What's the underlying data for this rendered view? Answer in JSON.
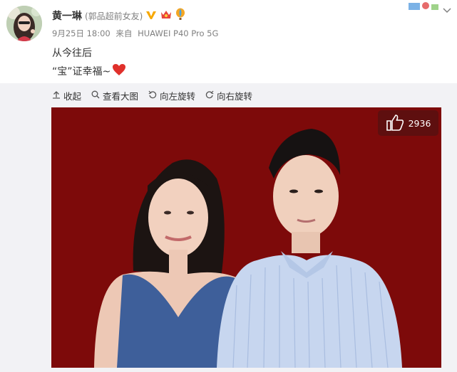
{
  "user": {
    "name": "黄一琳",
    "remark": "(郭品超前女友)"
  },
  "meta": {
    "time": "9月25日 18:00",
    "source_prefix": "来自",
    "device": "HUAWEI P40 Pro 5G"
  },
  "content": {
    "line1": "从今往后",
    "line2": "“宝”证幸福~"
  },
  "toolbar": {
    "collapse": "收起",
    "view_large": "查看大图",
    "rotate_left": "向左旋转",
    "rotate_right": "向右旋转"
  },
  "photo": {
    "likes": "2936",
    "background_color": "#7d0a0a"
  },
  "icons": [
    "avatar",
    "verified-icon",
    "crown-icon",
    "balloon-icon",
    "chevron-down-icon",
    "collapse-icon",
    "zoom-icon",
    "rotate-left-icon",
    "rotate-right-icon",
    "thumb-up-icon",
    "heart-icon"
  ]
}
